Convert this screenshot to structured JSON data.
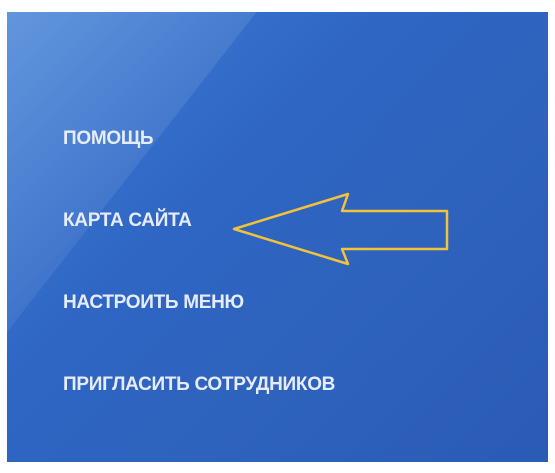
{
  "menu": {
    "items": [
      {
        "label": "ПОМОЩЬ"
      },
      {
        "label": "КАРТА САЙТА"
      },
      {
        "label": "НАСТРОИТЬ МЕНЮ"
      },
      {
        "label": "ПРИГЛАСИТЬ СОТРУДНИКОВ"
      }
    ]
  },
  "colors": {
    "panel_background": "#2f66c4",
    "menu_text": "#e6ecfb",
    "annotation_arrow": "#f2c23a"
  },
  "annotation": {
    "icon": "left-arrow-outline-icon",
    "points_to": "КАРТА САЙТА"
  }
}
